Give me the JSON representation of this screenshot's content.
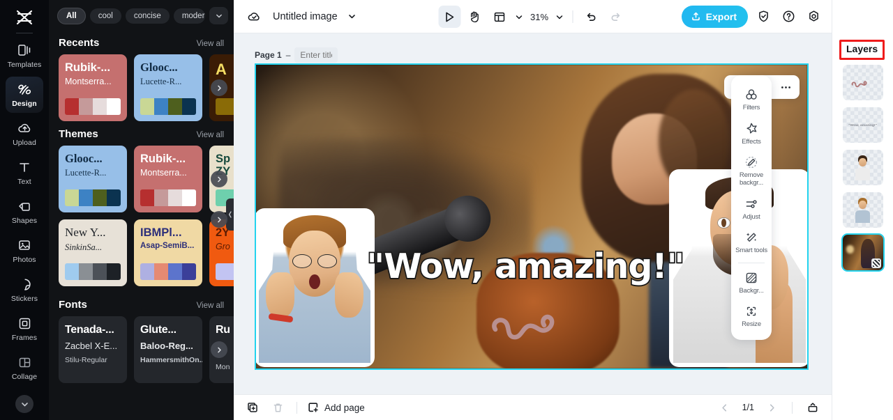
{
  "app": {
    "name": "CapCut Image Editor",
    "logo_icon": "capcut-logo-icon"
  },
  "rail": {
    "items": [
      {
        "label": "Templates",
        "icon": "templates-icon",
        "active": false
      },
      {
        "label": "Design",
        "icon": "design-icon",
        "active": true
      },
      {
        "label": "Upload",
        "icon": "upload-cloud-icon",
        "active": false
      },
      {
        "label": "Text",
        "icon": "text-icon",
        "active": false
      },
      {
        "label": "Shapes",
        "icon": "shapes-icon",
        "active": false
      },
      {
        "label": "Photos",
        "icon": "photos-icon",
        "active": false
      },
      {
        "label": "Stickers",
        "icon": "stickers-icon",
        "active": false
      },
      {
        "label": "Frames",
        "icon": "frames-icon",
        "active": false
      },
      {
        "label": "Collage",
        "icon": "collage-icon",
        "active": false
      }
    ],
    "more_icon": "chevron-down-icon"
  },
  "panel": {
    "chips": [
      {
        "label": "All",
        "selected": true
      },
      {
        "label": "cool",
        "selected": false
      },
      {
        "label": "concise",
        "selected": false
      },
      {
        "label": "modern",
        "selected": false
      }
    ],
    "chips_caret_icon": "chevron-down-icon",
    "sections": [
      {
        "title": "Recents",
        "view_all": "View all",
        "cards": [
          {
            "title": "Rubik-...",
            "subtitle": "Montserra...",
            "bg": "#c5706f",
            "title_color": "#ffffff",
            "sub_color": "#ffffff",
            "swatches": [
              "#b62f2f",
              "#c59a9a",
              "#e6dcdc",
              "#ffffff"
            ]
          },
          {
            "title": "Glooc...",
            "subtitle": "Lucette-R...",
            "bg": "#97bfe8",
            "title_color": "#102a43",
            "sub_color": "#16314a",
            "swatches": [
              "#c9d795",
              "#3d82c4",
              "#4e5f1e",
              "#0b3350"
            ]
          },
          {
            "title": "A",
            "subtitle": "",
            "bg": "#3a1c05",
            "title_color": "#f4dd63",
            "sub_color": "#f4dd63",
            "swatches": [
              "#8a6b07",
              "#8a6b07",
              "#8a6b07",
              "#8a6b07"
            ]
          }
        ]
      },
      {
        "title": "Themes",
        "view_all": "View all",
        "cards": [
          {
            "title": "Glooc...",
            "subtitle": "Lucette-R...",
            "bg": "#97bfe8",
            "title_color": "#102a43",
            "sub_color": "#16314a",
            "swatches": [
              "#c9d795",
              "#3d82c4",
              "#4e5f1e",
              "#0b3350"
            ]
          },
          {
            "title": "Rubik-...",
            "subtitle": "Montserra...",
            "bg": "#c5706f",
            "title_color": "#ffffff",
            "sub_color": "#ffffff",
            "swatches": [
              "#b62f2f",
              "#c59a9a",
              "#e6dcdc",
              "#ffffff"
            ]
          },
          {
            "title": "Sp",
            "subtitle": "ZY",
            "bg": "#e8e0cb",
            "title_color": "#15493c",
            "sub_color": "#15493c",
            "swatches": [
              "#6ed0ad",
              "#6ed0ad",
              "#6ed0ad",
              "#6ed0ad"
            ]
          }
        ]
      },
      {
        "title": "",
        "view_all": "",
        "cards": [
          {
            "title": "New Y...",
            "subtitle": "SinkinSa...",
            "bg": "#e7e1d7",
            "title_color": "#22262b",
            "sub_color": "#22262b",
            "swatches": [
              "#9fcbef",
              "#8a8f94",
              "#4c5158",
              "#1d2126"
            ]
          },
          {
            "title": "IBMPl...",
            "subtitle": "Asap-SemiB...",
            "bg": "#f0d9a4",
            "title_color": "#2d2f7a",
            "sub_color": "#2d2f7a",
            "swatches": [
              "#aeb0e2",
              "#e58a72",
              "#5c74cc",
              "#3b3f99"
            ]
          },
          {
            "title": "2Y",
            "subtitle": "Gro",
            "bg": "#f05a10",
            "title_color": "#5c1c02",
            "sub_color": "#5c1c02",
            "swatches": [
              "#c2c4f2",
              "#c2c4f2",
              "#c2c4f2",
              "#c2c4f2"
            ]
          }
        ]
      }
    ],
    "fonts_section": {
      "title": "Fonts",
      "view_all": "View all",
      "cards": [
        {
          "line1": "Tenada-...",
          "line2": "Zacbel X-E...",
          "line3": "Stilu-Regular"
        },
        {
          "line1": "Glute...",
          "line2": "Baloo-Reg...",
          "line3": "HammersmithOn..."
        },
        {
          "line1": "Ru",
          "line2": "",
          "line3": "Mon"
        }
      ]
    },
    "carousel_next_icon": "chevron-right-icon"
  },
  "topbar": {
    "cloud_icon": "cloud-sync-icon",
    "doc_title": "Untitled image",
    "doc_caret_icon": "chevron-down-icon",
    "select_tool_icon": "cursor-select-icon",
    "hand_tool_icon": "hand-pan-icon",
    "layout_tool_icon": "layout-grid-icon",
    "layout_caret_icon": "chevron-down-icon",
    "zoom_level": "31%",
    "zoom_caret_icon": "chevron-down-icon",
    "undo_icon": "undo-icon",
    "redo_icon": "redo-icon",
    "export_label": "Export",
    "export_icon": "export-upload-icon",
    "export_color": "#21bdef",
    "shield_icon": "shield-check-icon",
    "help_icon": "help-circle-icon",
    "settings_icon": "settings-gear-icon"
  },
  "canvas": {
    "page_label": "Page 1",
    "page_dash": "–",
    "title_placeholder": "Enter title",
    "duplicate_page_icon": "duplicate-page-icon",
    "float_tools": [
      {
        "icon": "crop-scan-icon",
        "name": "crop-tool"
      },
      {
        "icon": "qr-replace-icon",
        "name": "replace-tool"
      },
      {
        "icon": "more-dots-icon",
        "name": "more-options"
      }
    ],
    "selection_color": "#22d3ee",
    "artwork": {
      "headline": "\"Wow, amazing!\"",
      "headline_stroke": "#1a1a1a",
      "headline_fill": "#ffffff",
      "squiggle_color": "#b99090"
    }
  },
  "tools_panel": {
    "items": [
      {
        "label": "Filters",
        "icon": "filters-circles-icon"
      },
      {
        "label": "Effects",
        "icon": "effects-star-icon"
      },
      {
        "label": "Remove backgr...",
        "icon": "remove-background-icon"
      },
      {
        "label": "Adjust",
        "icon": "adjust-sliders-icon"
      },
      {
        "label": "Smart tools",
        "icon": "smart-tools-wand-icon"
      },
      {
        "label": "Backgr...",
        "icon": "background-swatch-icon"
      },
      {
        "label": "Resize",
        "icon": "resize-icon"
      }
    ]
  },
  "bottombar": {
    "duplicate_icon": "duplicate-icon",
    "delete_icon": "trash-icon",
    "add_page_label": "Add page",
    "add_page_icon": "add-page-icon",
    "prev_icon": "chevron-left-icon",
    "next_icon": "chevron-right-icon",
    "page_indicator": "1/1",
    "fullscreen_icon": "present-icon"
  },
  "layers": {
    "title": "Layers",
    "highlight_color": "#ef1c1c",
    "items": [
      {
        "name": "squiggle-layer",
        "type": "shape",
        "selected": false,
        "preview_text": ""
      },
      {
        "name": "text-layer",
        "type": "text",
        "selected": false,
        "preview_text": "\"Wow, amazing!\""
      },
      {
        "name": "man-right-layer",
        "type": "cutout",
        "selected": false,
        "preview_text": ""
      },
      {
        "name": "man-left-layer",
        "type": "cutout",
        "selected": false,
        "preview_text": ""
      },
      {
        "name": "background-photo-layer",
        "type": "photo",
        "selected": true,
        "preview_text": ""
      }
    ]
  }
}
